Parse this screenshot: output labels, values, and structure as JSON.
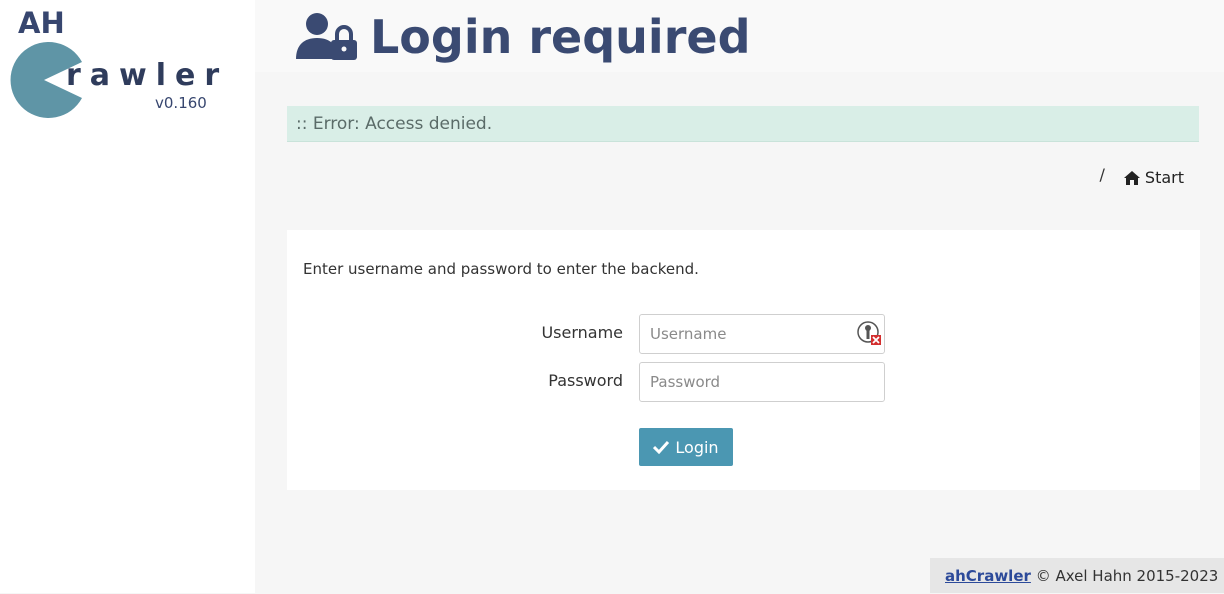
{
  "logo": {
    "ah": "AH",
    "word": "rawler",
    "version": "v0.160",
    "color": "#5f95a6"
  },
  "header": {
    "title": "Login required",
    "icon": "user-lock-icon"
  },
  "alert": {
    "text": ":: Error: Access denied."
  },
  "breadcrumb": {
    "separator": "/",
    "home_label": "Start",
    "home_icon": "home-icon"
  },
  "login": {
    "intro": "Enter username and password to enter the backend.",
    "username_label": "Username",
    "username_placeholder": "Username",
    "username_value": "",
    "password_label": "Password",
    "password_placeholder": "Password",
    "password_value": "",
    "button_label": "Login",
    "button_icon": "check-icon"
  },
  "footer": {
    "link_text": "ahCrawler",
    "copyright": "© Axel Hahn 2015-2023"
  },
  "colors": {
    "title": "#3a4a72",
    "alert_bg": "#d9eee7",
    "button": "#4b97b2"
  }
}
